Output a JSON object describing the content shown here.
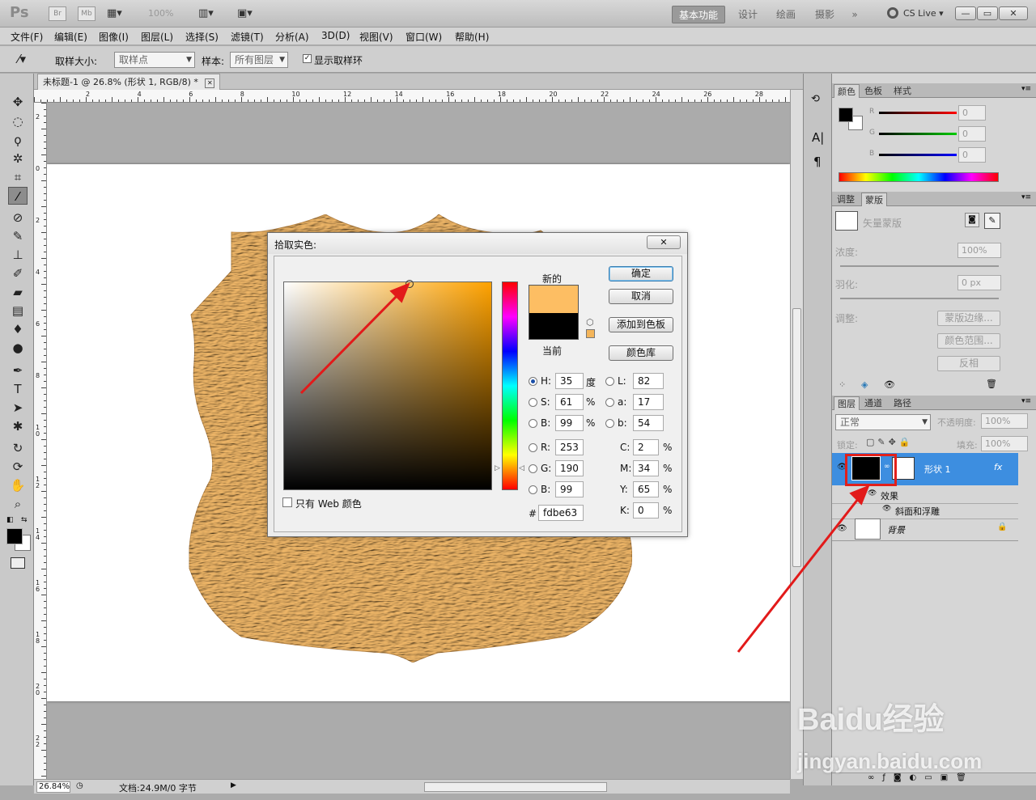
{
  "appbar": {
    "logo": "Ps",
    "br": "Br",
    "mb": "Mb",
    "zoom": "100%",
    "workspaces": [
      "基本功能",
      "设计",
      "绘画",
      "摄影"
    ],
    "more": "»",
    "cslive": "CS Live",
    "winbtns": [
      "—",
      "▭",
      "✕"
    ]
  },
  "menubar": {
    "items": [
      "文件(F)",
      "编辑(E)",
      "图像(I)",
      "图层(L)",
      "选择(S)",
      "滤镜(T)",
      "分析(A)",
      "3D(D)",
      "视图(V)",
      "窗口(W)",
      "帮助(H)"
    ]
  },
  "options": {
    "sample_size_label": "取样大小:",
    "sample_size_value": "取样点",
    "sample_label": "样本:",
    "sample_value": "所有图层",
    "show_ring_label": "显示取样环",
    "show_ring_checked": true
  },
  "document": {
    "tab_title": "未标题-1 @ 26.8% (形状 1, RGB/8) *",
    "close": "✕",
    "ruler_h": [
      "2",
      "4",
      "6",
      "8",
      "10",
      "12",
      "14",
      "16",
      "18",
      "20",
      "22",
      "24",
      "26",
      "28"
    ],
    "ruler_v": [
      "2",
      "0",
      "2",
      "4",
      "6",
      "8",
      "1 0",
      "1 2",
      "1 4",
      "1 6",
      "1 8",
      "2 0",
      "2 2"
    ],
    "shape_color": "#f1b869"
  },
  "status": {
    "zoom": "26.84%",
    "doc": "文档:24.9M/0 字节"
  },
  "color_panel": {
    "tabs": [
      "颜色",
      "色板",
      "样式"
    ],
    "channels": [
      "R",
      "G",
      "B"
    ],
    "values": [
      "0",
      "0",
      "0"
    ]
  },
  "masks_panel": {
    "tabs": [
      "调整",
      "蒙版"
    ],
    "vector_mask": "矢量蒙版",
    "density_label": "浓度:",
    "density_value": "100%",
    "feather_label": "羽化:",
    "feather_value": "0 px",
    "adjust_label": "调整:",
    "buttons": [
      "蒙版边缘...",
      "颜色范围...",
      "反相"
    ]
  },
  "layers_panel": {
    "tabs": [
      "图层",
      "通道",
      "路径"
    ],
    "blend_mode": "正常",
    "opacity_label": "不透明度:",
    "opacity_value": "100%",
    "lock_label": "锁定:",
    "fill_label": "填充:",
    "fill_value": "100%",
    "layers": [
      {
        "name": "形状 1",
        "fx": "fx",
        "effects_label": "效果",
        "effect": "斜面和浮雕"
      },
      {
        "name": "背景"
      }
    ]
  },
  "color_picker": {
    "title": "拾取实色:",
    "close": "✕",
    "new_label": "新的",
    "current_label": "当前",
    "new_color": "#fdbe63",
    "current_color": "#000000",
    "hue_color": "#ffa200",
    "buttons": {
      "ok": "确定",
      "cancel": "取消",
      "add_swatch": "添加到色板",
      "libraries": "颜色库"
    },
    "hsb": [
      {
        "label": "H:",
        "value": "35",
        "unit": "度"
      },
      {
        "label": "S:",
        "value": "61",
        "unit": "%"
      },
      {
        "label": "B:",
        "value": "99",
        "unit": "%"
      }
    ],
    "rgb": [
      {
        "label": "R:",
        "value": "253"
      },
      {
        "label": "G:",
        "value": "190"
      },
      {
        "label": "B:",
        "value": "99"
      }
    ],
    "lab": [
      {
        "label": "L:",
        "value": "82"
      },
      {
        "label": "a:",
        "value": "17"
      },
      {
        "label": "b:",
        "value": "54"
      }
    ],
    "cmyk": [
      {
        "label": "C:",
        "value": "2",
        "unit": "%"
      },
      {
        "label": "M:",
        "value": "34",
        "unit": "%"
      },
      {
        "label": "Y:",
        "value": "65",
        "unit": "%"
      },
      {
        "label": "K:",
        "value": "0",
        "unit": "%"
      }
    ],
    "web_only_label": "只有 Web 颜色",
    "hex_label": "#",
    "hex_value": "fdbe63"
  },
  "watermark": {
    "brand": "Baidu经验",
    "url": "jingyan.baidu.com"
  }
}
